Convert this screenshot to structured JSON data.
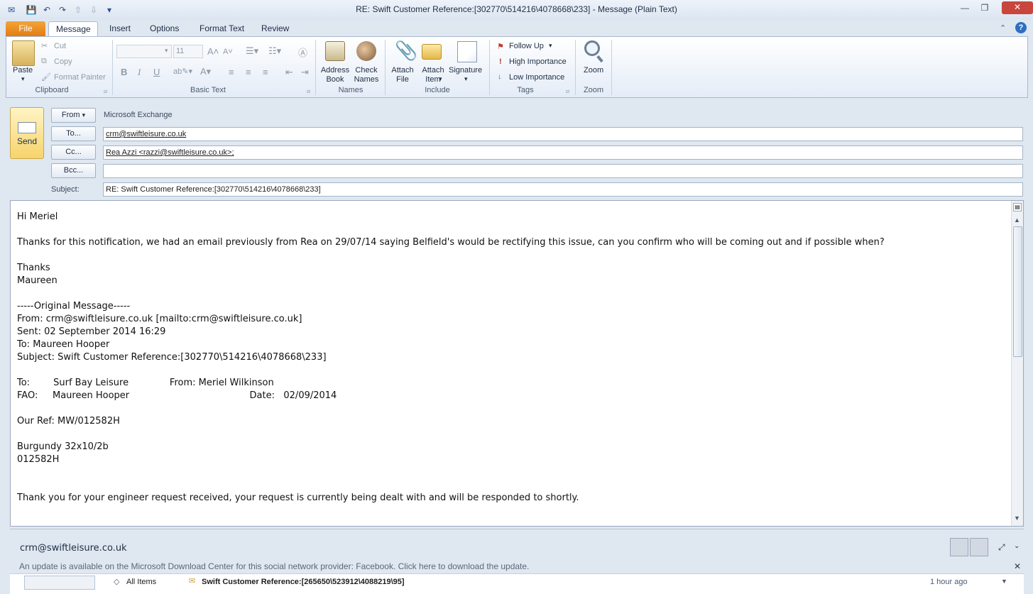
{
  "window": {
    "title": "RE: Swift Customer Reference:[302770\\514216\\4078668\\233]  -  Message (Plain Text)",
    "controls": {
      "minimize": "—",
      "restore": "❐",
      "close": "✕"
    }
  },
  "tabs": [
    "File",
    "Message",
    "Insert",
    "Options",
    "Format Text",
    "Review"
  ],
  "ribbon": {
    "clipboard": {
      "paste": "Paste",
      "cut": "Cut",
      "copy": "Copy",
      "format_painter": "Format Painter",
      "label": "Clipboard"
    },
    "basic_text": {
      "font_size": "11",
      "label": "Basic Text"
    },
    "names": {
      "address_book": "Address Book",
      "check_names": "Check Names",
      "label": "Names"
    },
    "include": {
      "attach_file": "Attach File",
      "attach_item": "Attach Item",
      "signature": "Signature",
      "label": "Include"
    },
    "tags": {
      "follow_up": "Follow Up",
      "high_importance": "High Importance",
      "low_importance": "Low Importance",
      "label": "Tags"
    },
    "zoom": {
      "zoom": "Zoom",
      "label": "Zoom"
    }
  },
  "header": {
    "send": "Send",
    "from_btn": "From",
    "from_value": "Microsoft Exchange",
    "to_btn": "To...",
    "to_value": "crm@swiftleisure.co.uk",
    "cc_btn": "Cc...",
    "cc_value": "Rea Azzi <razzi@swiftleisure.co.uk>;",
    "bcc_btn": "Bcc...",
    "bcc_value": "",
    "subject_label": "Subject:",
    "subject_value": "RE: Swift Customer Reference:[302770\\514216\\4078668\\233]"
  },
  "body": {
    "text": "Hi Meriel\n\nThanks for this notification, we had an email previously from Rea on 29/07/14 saying Belfield's would be rectifying this issue, can you confirm who will be coming out and if possible when?\n\nThanks\nMaureen\n\n-----Original Message-----\nFrom: crm@swiftleisure.co.uk [mailto:crm@swiftleisure.co.uk]\nSent: 02 September 2014 16:29\nTo: Maureen Hooper\nSubject: Swift Customer Reference:[302770\\514216\\4078668\\233]\n\nTo:        Surf Bay Leisure              From: Meriel Wilkinson\nFAO:     Maureen Hooper                                         Date:   02/09/2014\n\nOur Ref: MW/012582H\n\nBurgundy 32x10/2b\n012582H\n\n\nThank you for your engineer request received, your request is currently being dealt with and will be responded to shortly."
  },
  "people_pane": {
    "contact": "crm@swiftleisure.co.uk",
    "update_notice": "An update is available on the Microsoft Download Center for this social network provider: Facebook. Click here to download the update.",
    "list_filter": "All Items",
    "list_item_subject": "Swift Customer Reference:[265650\\523912\\4088219\\95]",
    "list_item_time": "1 hour ago"
  },
  "colors": {
    "file_tab": "#e07a12",
    "send": "#f6d46b",
    "accent": "#2a4f8a"
  }
}
